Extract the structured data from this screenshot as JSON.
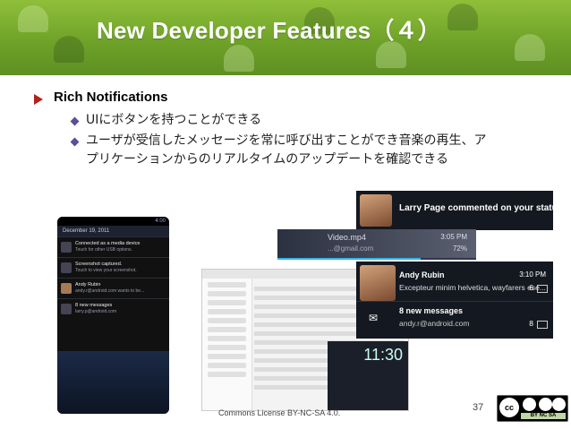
{
  "slide": {
    "title": "New Developer Features（４）",
    "heading": "Rich Notifications",
    "bullets": [
      "UIにボタンを持つことができる",
      "ユーザが受信したメッセージを常に呼び出すことができ音楽の再生、ア",
      "プリケーションからのリアルタイムのアップデートを確認できる"
    ],
    "page_number": "37",
    "footer": "Commons License BY-NC-SA 4.0."
  },
  "phone": {
    "clock": "4:00",
    "date": "December 19, 2011",
    "items": [
      {
        "title": "Connected as a media device",
        "sub": "Touch for other USB options."
      },
      {
        "title": "Screenshot captured.",
        "sub": "Touch to view your screenshot."
      },
      {
        "title": "Andy Rubin",
        "sub": "andy.r@android.com wants to be..."
      },
      {
        "title": "8 new messages",
        "sub": "larry.p@android.com"
      }
    ]
  },
  "tablet": {
    "clock": "11:30"
  },
  "notifications": {
    "larry": "Larry Page commented on your status",
    "video": {
      "title": "Video.mp4",
      "sub": "...@gmail.com",
      "time": "3:05 PM",
      "percent": "72%",
      "progress": 0.72
    },
    "andy": {
      "name": "Andy Rubin",
      "time": "3:10 PM",
      "msg": "Excepteur minim helvetica, wayfarers ese...",
      "count": "6"
    },
    "mail": {
      "title": "8 new messages",
      "from": "andy.r@android.com",
      "count": "8"
    }
  },
  "cc": {
    "mark": "cc",
    "license": "BY NC SA"
  }
}
